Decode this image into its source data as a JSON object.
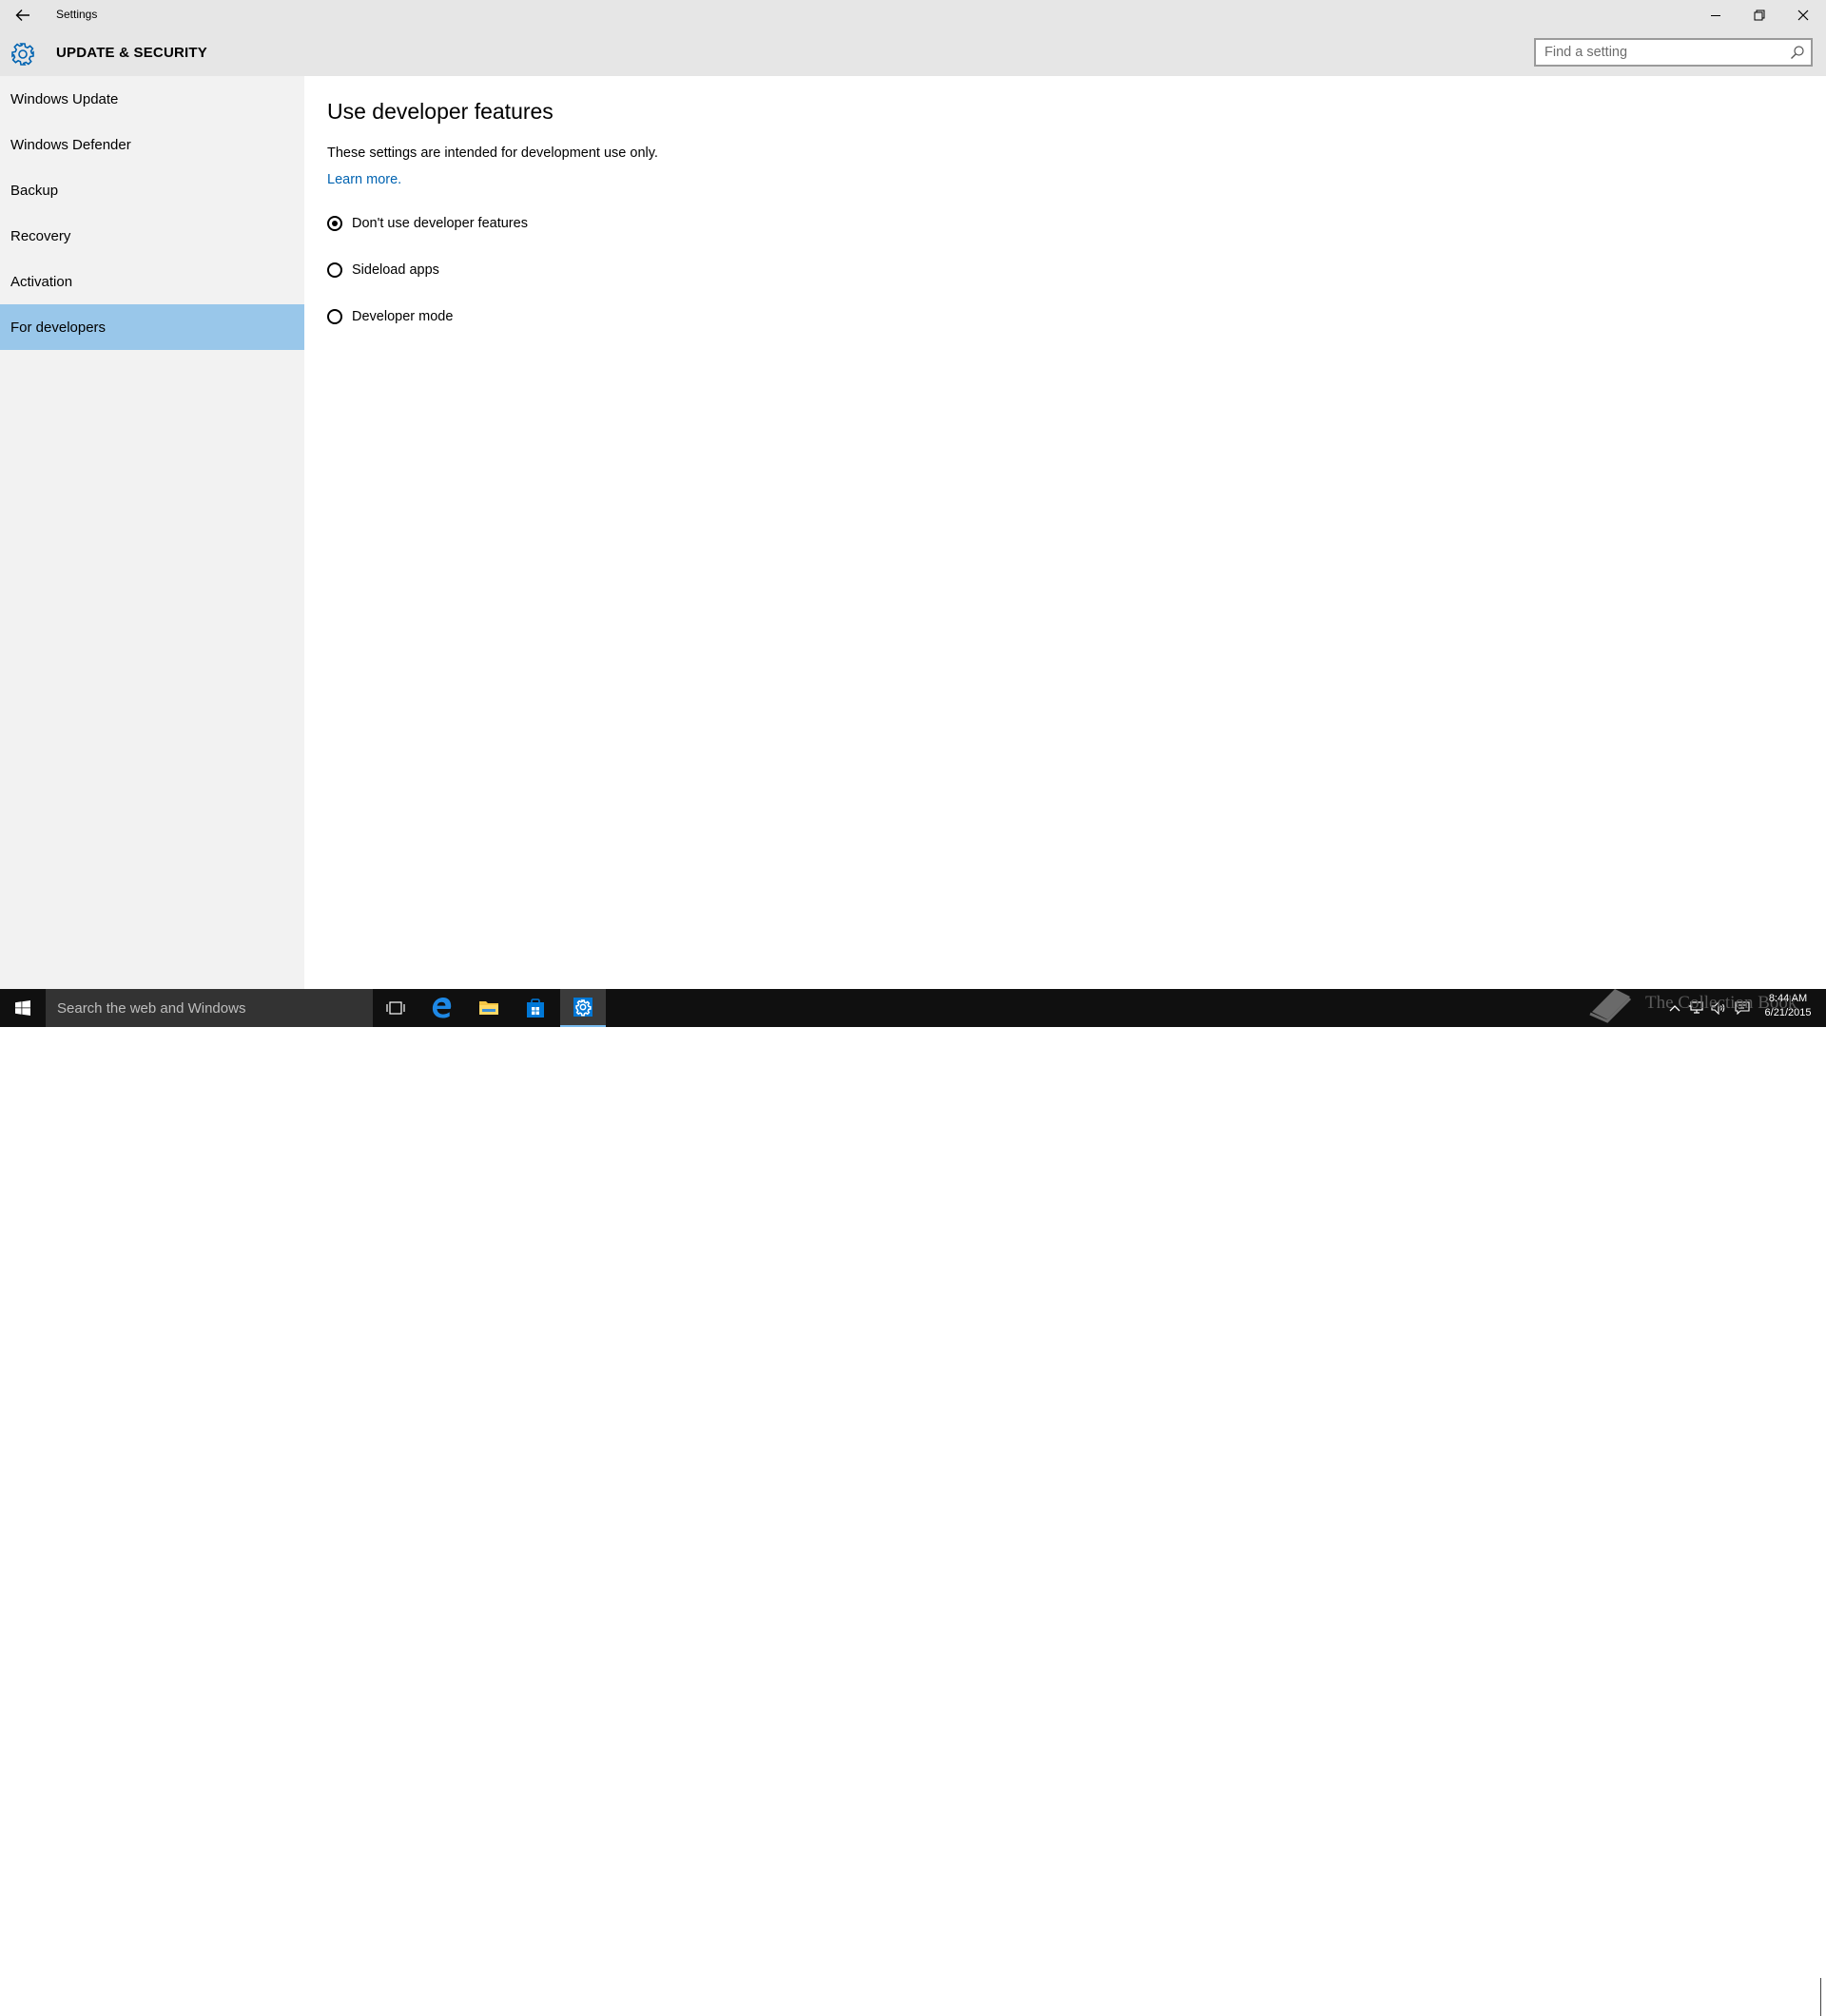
{
  "window": {
    "title": "Settings",
    "section_title": "UPDATE & SECURITY",
    "search_placeholder": "Find a setting"
  },
  "sidebar": {
    "items": [
      {
        "label": "Windows Update"
      },
      {
        "label": "Windows Defender"
      },
      {
        "label": "Backup"
      },
      {
        "label": "Recovery"
      },
      {
        "label": "Activation"
      },
      {
        "label": "For developers",
        "selected": true
      }
    ]
  },
  "content": {
    "title": "Use developer features",
    "description": "These settings are intended for development use only.",
    "learn_more": "Learn more.",
    "options": [
      {
        "label": "Don't use developer features",
        "checked": true
      },
      {
        "label": "Sideload apps",
        "checked": false
      },
      {
        "label": "Developer mode",
        "checked": false
      }
    ]
  },
  "taskbar": {
    "search_placeholder": "Search the web and Windows",
    "apps": [
      "task-view-icon",
      "edge-icon",
      "file-explorer-icon",
      "store-icon",
      "settings-icon"
    ],
    "active_app": "settings-icon",
    "clock_time": "8:44 AM",
    "clock_date": "6/21/2015",
    "watermark": "The Collection Book"
  },
  "colors": {
    "accent": "#0063b1",
    "selected_nav": "#99c7ea",
    "titlebar_bg": "#e6e6e6",
    "sidebar_bg": "#f2f2f2",
    "taskbar_bg": "#101010"
  }
}
